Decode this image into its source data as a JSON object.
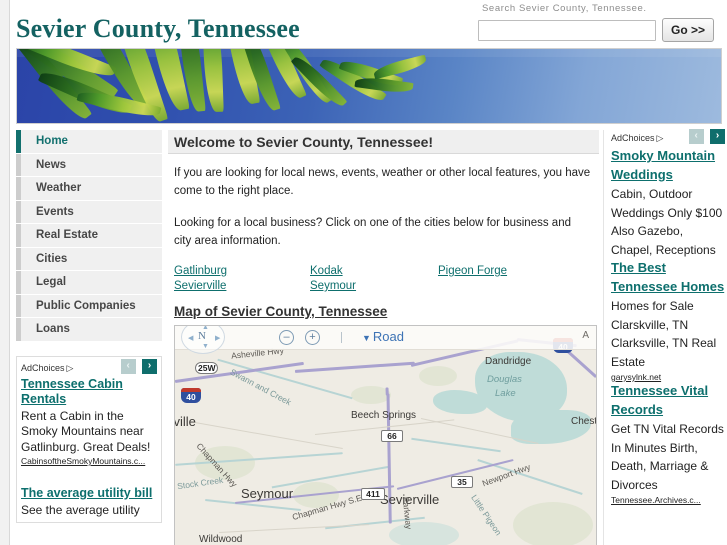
{
  "site": {
    "title": "Sevier County, Tennessee"
  },
  "search": {
    "label": "Search Sevier County, Tennessee.",
    "value": "",
    "placeholder": "",
    "button_label": "Go >>"
  },
  "nav": {
    "items": [
      {
        "label": "Home",
        "active": true
      },
      {
        "label": "News",
        "active": false
      },
      {
        "label": "Weather",
        "active": false
      },
      {
        "label": "Events",
        "active": false
      },
      {
        "label": "Real Estate",
        "active": false
      },
      {
        "label": "Cities",
        "active": false
      },
      {
        "label": "Legal",
        "active": false
      },
      {
        "label": "Public Companies",
        "active": false
      },
      {
        "label": "Loans",
        "active": false
      }
    ]
  },
  "main": {
    "heading": "Welcome to Sevier County, Tennessee!",
    "paragraph1": "If you are looking for local news, events, weather or other local features, you have come to the right place.",
    "paragraph2": "Looking for a local business? Click on one of the cities below for business and city area information.",
    "city_columns": [
      {
        "links": [
          "Gatlinburg",
          "Sevierville"
        ]
      },
      {
        "links": [
          "Kodak",
          "Seymour"
        ]
      },
      {
        "links": [
          "Pigeon Forge"
        ]
      }
    ],
    "map_heading": "Map of Sevier County, Tennessee"
  },
  "map": {
    "view_label": "Road",
    "compass_label": "N",
    "zoom_out": "–",
    "zoom_in": "+",
    "corner_letter": "A",
    "labels": [
      "25W",
      "Asheville Hwy",
      "Swann and Creek",
      "Dandridge",
      "Douglas Lake",
      "Beech Springs",
      "Chestnut",
      "Seymour",
      "Sevierville",
      "Stock Creek",
      "Chapman Hwy",
      "Chapman Hwy S.E.",
      "Newport Hwy",
      "Little Pigeon",
      "Parkway",
      "Wildwood",
      "xville"
    ],
    "shields": [
      "40",
      "40",
      "66",
      "411",
      "35"
    ]
  },
  "ads_left": {
    "adchoices_label": "AdChoices",
    "prev_label": "‹",
    "next_label": "›",
    "items": [
      {
        "title": "Tennessee Cabin Rentals",
        "body": "Rent a Cabin in the Smoky Mountains near Gatlinburg. Great Deals!",
        "url": "CabinsoftheSmokyMountains.c..."
      },
      {
        "title": "The average utility bill",
        "body": "See the average utility",
        "url": ""
      }
    ]
  },
  "ads_right": {
    "adchoices_label": "AdChoices",
    "prev_label": "‹",
    "next_label": "›",
    "items": [
      {
        "title": "Smoky Mountain Weddings",
        "body": "Cabin, Outdoor Weddings Only $100 Also Gazebo, Chapel, Receptions",
        "url": ""
      },
      {
        "title": "The Best Tennessee Homes",
        "body": "Homes for Sale Clarskville, TN Clarksville, TN Real Estate",
        "url": "garysylnk.net"
      },
      {
        "title": "Tennessee Vital Records",
        "body": "Get TN Vital Records In Minutes Birth, Death, Marriage & Divorces",
        "url": "Tennessee.Archives.c..."
      }
    ]
  },
  "colors": {
    "brand_teal": "#0e6f6d",
    "title_teal": "#146262",
    "nav_bg": "#f0f0f0",
    "banner_blue": "#2f4fae"
  }
}
